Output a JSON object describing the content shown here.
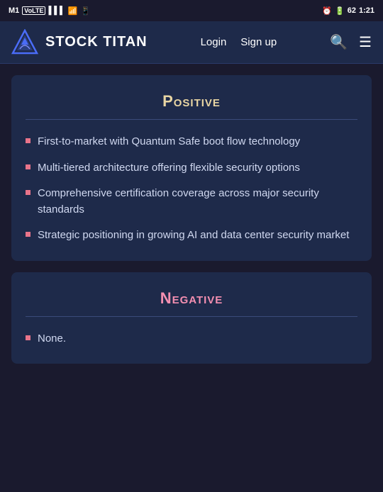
{
  "statusBar": {
    "carrier": "M1",
    "network": "VoLTE",
    "time": "1:21",
    "battery": "62"
  },
  "navbar": {
    "brandName": "STOCK TITAN",
    "loginLabel": "Login",
    "signupLabel": "Sign up"
  },
  "sections": [
    {
      "id": "positive",
      "title": "Positive",
      "titleClass": "positive",
      "items": [
        "First-to-market with Quantum Safe boot flow technology",
        "Multi-tiered architecture offering flexible security options",
        "Comprehensive certification coverage across major security standards",
        "Strategic positioning in growing AI and data center security market"
      ]
    },
    {
      "id": "negative",
      "title": "Negative",
      "titleClass": "negative",
      "items": [
        "None."
      ]
    }
  ]
}
